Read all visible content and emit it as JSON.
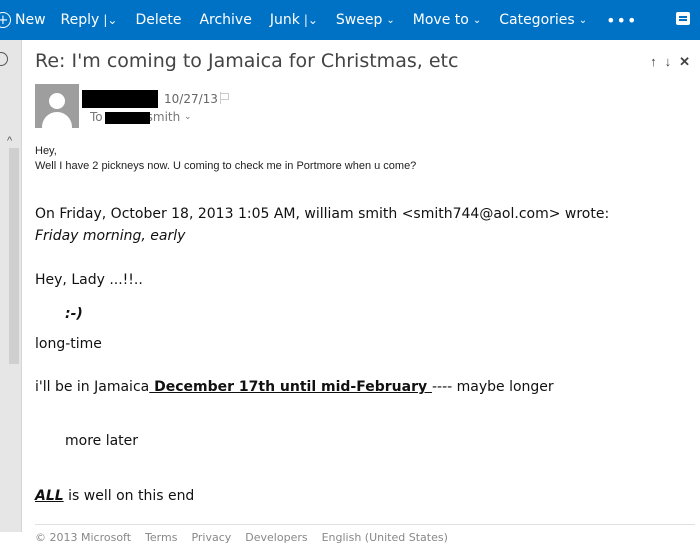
{
  "toolbar": {
    "new_label": "New",
    "reply_label": "Reply",
    "delete_label": "Delete",
    "archive_label": "Archive",
    "junk_label": "Junk",
    "sweep_label": "Sweep",
    "moveto_label": "Move to",
    "categories_label": "Categories",
    "more_label": "•••",
    "color": "#0072c6"
  },
  "message": {
    "subject": "Re: I'm coming to Jamaica for Christmas, etc",
    "date": "10/27/13",
    "to_prefix": "To",
    "to_suffix": "smith",
    "reply_lines": [
      "Hey,",
      "Well I have 2 pickneys now. U coming to check me in Portmore when u come?"
    ],
    "quoted": {
      "header": "On Friday, October 18, 2013 1:05 AM, william smith <smith744@aol.com> wrote:",
      "line1": "Friday morning, early",
      "line2": "Hey, Lady ...!!..",
      "line3": ":-)",
      "line4": "long-time",
      "line5_a": "i'll be in Jamaica",
      "line5_b": " December 17th until mid-February ",
      "line5_c": "---- maybe longer",
      "line6": "more later",
      "line7_a": "ALL",
      "line7_b": " is well on this end"
    }
  },
  "footer": {
    "copyright": "© 2013 Microsoft",
    "terms": "Terms",
    "privacy": "Privacy",
    "developers": "Developers",
    "language": "English (United States)"
  }
}
